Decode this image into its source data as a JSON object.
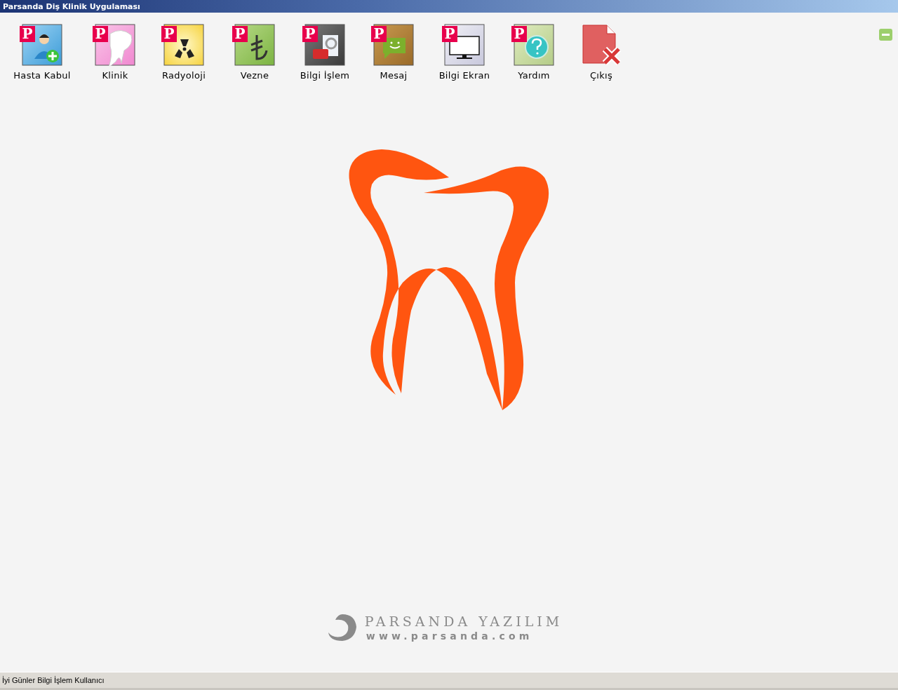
{
  "window": {
    "title": "Parsanda Diş Klinik Uygulaması"
  },
  "toolbar": [
    {
      "label": "Hasta Kabul",
      "badge": "P",
      "kind": "patient"
    },
    {
      "label": "Klinik",
      "badge": "P",
      "kind": "tooth"
    },
    {
      "label": "Radyoloji",
      "badge": "P",
      "kind": "radiation"
    },
    {
      "label": "Vezne",
      "badge": "P",
      "kind": "lira"
    },
    {
      "label": "Bilgi İşlem",
      "badge": "P",
      "kind": "tools"
    },
    {
      "label": "Mesaj",
      "badge": "P",
      "kind": "message"
    },
    {
      "label": "Bilgi Ekran",
      "badge": "P",
      "kind": "monitor"
    },
    {
      "label": "Yardım",
      "badge": "P",
      "kind": "help"
    },
    {
      "label": "Çıkış",
      "kind": "exit"
    }
  ],
  "footer": {
    "brand": "PARSANDA YAZILIM",
    "website": "www.parsanda.com"
  },
  "status_bar": {
    "text": "İyi Günler Bilgi İşlem Kullanıcı"
  }
}
